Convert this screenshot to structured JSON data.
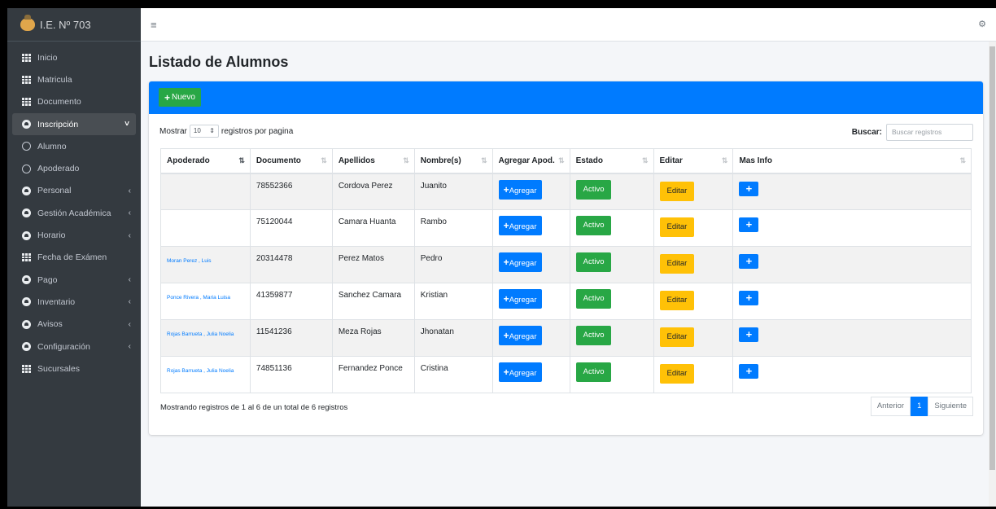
{
  "brand": {
    "name": "I.E. Nº 703"
  },
  "sidebar": {
    "items": [
      {
        "label": "Inicio",
        "icon": "table-icon"
      },
      {
        "label": "Matricula",
        "icon": "table-icon"
      },
      {
        "label": "Documento",
        "icon": "table-icon"
      },
      {
        "label": "Inscripción",
        "icon": "dashboard-icon",
        "active": true,
        "chevron": "chevron-down"
      },
      {
        "label": "Alumno",
        "icon": "circle-icon"
      },
      {
        "label": "Apoderado",
        "icon": "circle-icon"
      },
      {
        "label": "Personal",
        "icon": "dashboard-icon",
        "chevron": "chevron-left"
      },
      {
        "label": "Gestión Académica",
        "icon": "dashboard-icon",
        "chevron": "chevron-left"
      },
      {
        "label": "Horario",
        "icon": "dashboard-icon",
        "chevron": "chevron-left"
      },
      {
        "label": "Fecha de Exámen",
        "icon": "table-icon"
      },
      {
        "label": "Pago",
        "icon": "dashboard-icon",
        "chevron": "chevron-left"
      },
      {
        "label": "Inventario",
        "icon": "dashboard-icon",
        "chevron": "chevron-left"
      },
      {
        "label": "Avisos",
        "icon": "dashboard-icon",
        "chevron": "chevron-left"
      },
      {
        "label": "Configuración",
        "icon": "dashboard-icon",
        "chevron": "chevron-left"
      },
      {
        "label": "Sucursales",
        "icon": "table-icon"
      }
    ]
  },
  "header": {
    "title": "Listado de Alumnos"
  },
  "toolbar": {
    "new_label": "Nuevo"
  },
  "controls": {
    "show_prefix": "Mostrar",
    "page_size": "10",
    "show_suffix": "registros por pagina",
    "search_label": "Buscar:",
    "search_placeholder": "Buscar registros"
  },
  "table": {
    "columns": [
      "Apoderado",
      "Documento",
      "Apellidos",
      "Nombre(s)",
      "Agregar Apod.",
      "Estado",
      "Editar",
      "Mas Info"
    ],
    "rows": [
      {
        "apoderado": "",
        "documento": "78552366",
        "apellidos": "Cordova Perez",
        "nombres": "Juanito",
        "agregar": "Agregar",
        "estado": "Activo",
        "editar": "Editar",
        "info": "+"
      },
      {
        "apoderado": "",
        "documento": "75120044",
        "apellidos": "Camara Huanta",
        "nombres": "Rambo",
        "agregar": "Agregar",
        "estado": "Activo",
        "editar": "Editar",
        "info": "+"
      },
      {
        "apoderado": "Moran Perez , Luis",
        "documento": "20314478",
        "apellidos": "Perez Matos",
        "nombres": "Pedro",
        "agregar": "Agregar",
        "estado": "Activo",
        "editar": "Editar",
        "info": "+"
      },
      {
        "apoderado": "Ponce Rivera , Maria Luisa",
        "documento": "41359877",
        "apellidos": "Sanchez Camara",
        "nombres": "Kristian",
        "agregar": "Agregar",
        "estado": "Activo",
        "editar": "Editar",
        "info": "+"
      },
      {
        "apoderado": "Rojas Barrueta , Julia Noelia",
        "documento": "11541236",
        "apellidos": "Meza Rojas",
        "nombres": "Jhonatan",
        "agregar": "Agregar",
        "estado": "Activo",
        "editar": "Editar",
        "info": "+"
      },
      {
        "apoderado": "Rojas Barrueta , Julia Noelia",
        "documento": "74851136",
        "apellidos": "Fernandez Ponce",
        "nombres": "Cristina",
        "agregar": "Agregar",
        "estado": "Activo",
        "editar": "Editar",
        "info": "+"
      }
    ]
  },
  "footer": {
    "info": "Mostrando registros de 1 al 6 de un total de 6 registros",
    "prev": "Anterior",
    "page": "1",
    "next": "Siguiente"
  },
  "colors": {
    "primary": "#007bff",
    "success": "#28a745",
    "warning": "#ffc107",
    "sidebar": "#343a40"
  }
}
